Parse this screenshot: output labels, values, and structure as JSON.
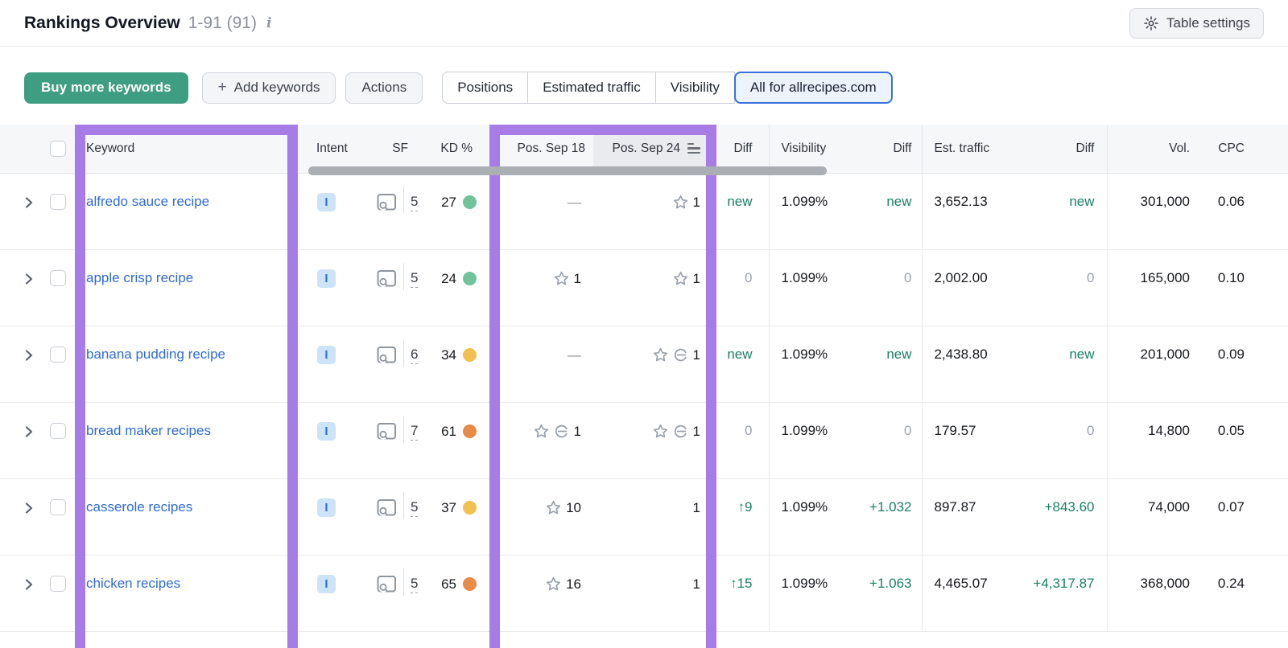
{
  "header": {
    "title": "Rankings Overview",
    "range": "1-91 (91)",
    "table_settings_label": "Table settings"
  },
  "toolbar": {
    "buy_label": "Buy more keywords",
    "add_label": "Add keywords",
    "add_plus": "+",
    "actions_label": "Actions",
    "tabs": [
      {
        "label": "Positions",
        "selected": false
      },
      {
        "label": "Estimated traffic",
        "selected": false
      },
      {
        "label": "Visibility",
        "selected": false
      },
      {
        "label": "All for allrecipes.com",
        "selected": true
      }
    ]
  },
  "table": {
    "headers": {
      "keyword": "Keyword",
      "intent": "Intent",
      "sf": "SF",
      "kd": "KD %",
      "pos18": "Pos. Sep 18",
      "pos24": "Pos. Sep 24",
      "diff1": "Diff",
      "visibility": "Visibility",
      "diff2": "Diff",
      "traffic": "Est. traffic",
      "diff3": "Diff",
      "volume": "Vol.",
      "cpc": "CPC"
    },
    "rows": [
      {
        "keyword": "alfredo sauce recipe",
        "intent": "I",
        "sf": "5",
        "kd": "27",
        "kd_level": "green",
        "pos18": {
          "dash": true
        },
        "pos24": {
          "star": true,
          "link": false,
          "value": "1"
        },
        "diff": {
          "style": "new",
          "text": "new"
        },
        "visibility": "1.099%",
        "vis_diff": {
          "style": "new",
          "text": "new"
        },
        "traffic": "3,652.13",
        "traffic_diff": {
          "style": "new",
          "text": "new"
        },
        "volume": "301,000",
        "cpc": "0.06"
      },
      {
        "keyword": "apple crisp recipe",
        "intent": "I",
        "sf": "5",
        "kd": "24",
        "kd_level": "green",
        "pos18": {
          "star": true,
          "link": false,
          "value": "1"
        },
        "pos24": {
          "star": true,
          "link": false,
          "value": "1"
        },
        "diff": {
          "style": "zero",
          "text": "0"
        },
        "visibility": "1.099%",
        "vis_diff": {
          "style": "zero",
          "text": "0"
        },
        "traffic": "2,002.00",
        "traffic_diff": {
          "style": "zero",
          "text": "0"
        },
        "volume": "165,000",
        "cpc": "0.10"
      },
      {
        "keyword": "banana pudding recipe",
        "intent": "I",
        "sf": "6",
        "kd": "34",
        "kd_level": "yellow",
        "pos18": {
          "dash": true
        },
        "pos24": {
          "star": true,
          "link": true,
          "value": "1"
        },
        "diff": {
          "style": "new",
          "text": "new"
        },
        "visibility": "1.099%",
        "vis_diff": {
          "style": "new",
          "text": "new"
        },
        "traffic": "2,438.80",
        "traffic_diff": {
          "style": "new",
          "text": "new"
        },
        "volume": "201,000",
        "cpc": "0.09"
      },
      {
        "keyword": "bread maker recipes",
        "intent": "I",
        "sf": "7",
        "kd": "61",
        "kd_level": "orange",
        "pos18": {
          "star": true,
          "link": true,
          "value": "1"
        },
        "pos24": {
          "star": true,
          "link": true,
          "value": "1"
        },
        "diff": {
          "style": "zero",
          "text": "0"
        },
        "visibility": "1.099%",
        "vis_diff": {
          "style": "zero",
          "text": "0"
        },
        "traffic": "179.57",
        "traffic_diff": {
          "style": "zero",
          "text": "0"
        },
        "volume": "14,800",
        "cpc": "0.05"
      },
      {
        "keyword": "casserole recipes",
        "intent": "I",
        "sf": "5",
        "kd": "37",
        "kd_level": "yellow",
        "pos18": {
          "star": true,
          "link": false,
          "value": "10"
        },
        "pos24": {
          "value": "1"
        },
        "diff": {
          "style": "up",
          "text": "9"
        },
        "visibility": "1.099%",
        "vis_diff": {
          "style": "up-plain",
          "text": "+1.032"
        },
        "traffic": "897.87",
        "traffic_diff": {
          "style": "up-plain",
          "text": "+843.60"
        },
        "volume": "74,000",
        "cpc": "0.07"
      },
      {
        "keyword": "chicken recipes",
        "intent": "I",
        "sf": "5",
        "kd": "65",
        "kd_level": "orange",
        "pos18": {
          "star": true,
          "link": false,
          "value": "16"
        },
        "pos24": {
          "value": "1"
        },
        "diff": {
          "style": "up",
          "text": "15"
        },
        "visibility": "1.099%",
        "vis_diff": {
          "style": "up-plain",
          "text": "+1.063"
        },
        "traffic": "4,465.07",
        "traffic_diff": {
          "style": "up-plain",
          "text": "+4,317.87"
        },
        "volume": "368,000",
        "cpc": "0.24"
      }
    ]
  },
  "colors": {
    "highlight_purple": "#a87ce6",
    "buy_button_green": "#3f9e81",
    "keyword_link_blue": "#2e6bd8",
    "positive_green": "#1a8066",
    "neutral_gray": "#9ba1aa",
    "kd_green": "#6fc49b",
    "kd_yellow": "#f1c050",
    "kd_orange": "#e98a47",
    "selected_tab_border": "#3a72dd"
  }
}
